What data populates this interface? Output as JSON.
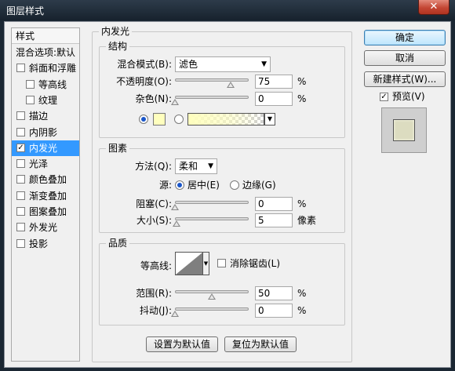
{
  "window": {
    "title": "图层样式",
    "close_glyph": "✕"
  },
  "left_list": {
    "header": "样式",
    "items": [
      {
        "label": "混合选项:默认",
        "checkbox": false,
        "checked": false,
        "indent": 0,
        "selected": false
      },
      {
        "label": "斜面和浮雕",
        "checkbox": true,
        "checked": false,
        "indent": 0,
        "selected": false
      },
      {
        "label": "等高线",
        "checkbox": true,
        "checked": false,
        "indent": 1,
        "selected": false
      },
      {
        "label": "纹理",
        "checkbox": true,
        "checked": false,
        "indent": 1,
        "selected": false
      },
      {
        "label": "描边",
        "checkbox": true,
        "checked": false,
        "indent": 0,
        "selected": false
      },
      {
        "label": "内阴影",
        "checkbox": true,
        "checked": false,
        "indent": 0,
        "selected": false
      },
      {
        "label": "内发光",
        "checkbox": true,
        "checked": true,
        "indent": 0,
        "selected": true
      },
      {
        "label": "光泽",
        "checkbox": true,
        "checked": false,
        "indent": 0,
        "selected": false
      },
      {
        "label": "颜色叠加",
        "checkbox": true,
        "checked": false,
        "indent": 0,
        "selected": false
      },
      {
        "label": "渐变叠加",
        "checkbox": true,
        "checked": false,
        "indent": 0,
        "selected": false
      },
      {
        "label": "图案叠加",
        "checkbox": true,
        "checked": false,
        "indent": 0,
        "selected": false
      },
      {
        "label": "外发光",
        "checkbox": true,
        "checked": false,
        "indent": 0,
        "selected": false
      },
      {
        "label": "投影",
        "checkbox": true,
        "checked": false,
        "indent": 0,
        "selected": false
      }
    ]
  },
  "panel": {
    "title": "内发光",
    "structure": {
      "legend": "结构",
      "blend_mode_label": "混合模式(B):",
      "blend_mode_value": "滤色",
      "opacity_label": "不透明度(O):",
      "opacity_value": "75",
      "noise_label": "杂色(N):",
      "noise_value": "0",
      "percent": "%",
      "glow_color": "#ffffbe",
      "color_radio_selected": true,
      "gradient_radio_selected": false
    },
    "elements": {
      "legend": "图素",
      "technique_label": "方法(Q):",
      "technique_value": "柔和",
      "source_label": "源:",
      "source_center_label": "居中(E)",
      "source_edge_label": "边缘(G)",
      "source_selected": "center",
      "choke_label": "阻塞(C):",
      "choke_value": "0",
      "size_label": "大小(S):",
      "size_value": "5",
      "size_unit": "像素",
      "percent": "%"
    },
    "quality": {
      "legend": "品质",
      "contour_label": "等高线:",
      "antialias_label": "消除锯齿(L)",
      "antialias_checked": false,
      "range_label": "范围(R):",
      "range_value": "50",
      "jitter_label": "抖动(J):",
      "jitter_value": "0",
      "percent": "%"
    },
    "default_buttons": {
      "set_default": "设置为默认值",
      "reset_default": "复位为默认值"
    }
  },
  "right": {
    "ok": "确定",
    "cancel": "取消",
    "new_style": "新建样式(W)...",
    "preview_label": "预览(V)",
    "preview_checked": true
  }
}
